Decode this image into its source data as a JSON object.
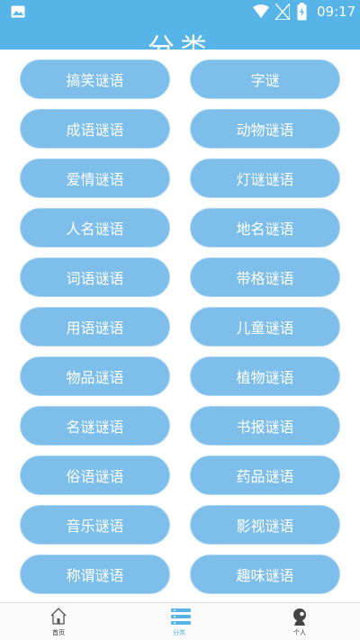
{
  "status_bar": {
    "time": "09:17",
    "icons": [
      "image-icon",
      "wifi-icon",
      "signal-icon",
      "battery-icon"
    ],
    "color": "#56b4e6"
  },
  "header": {
    "title": "分类"
  },
  "categories": [
    "搞笑谜语",
    "字谜",
    "成语谜语",
    "动物谜语",
    "爱情谜语",
    "灯谜谜语",
    "人名谜语",
    "地名谜语",
    "词语谜语",
    "带格谜语",
    "用语谜语",
    "儿童谜语",
    "物品谜语",
    "植物谜语",
    "名谜谜语",
    "书报谜语",
    "俗语谜语",
    "药品谜语",
    "音乐谜语",
    "影视谜语",
    "称谓谜语",
    "趣味谜语"
  ],
  "bottom_nav": {
    "items": [
      {
        "label": "首页",
        "icon": "home-icon",
        "active": false
      },
      {
        "label": "分类",
        "icon": "list-icon",
        "active": true
      },
      {
        "label": "个人",
        "icon": "user-icon",
        "active": false
      }
    ]
  },
  "colors": {
    "accent": "#56b4e6",
    "pill": "#7dbfea"
  }
}
